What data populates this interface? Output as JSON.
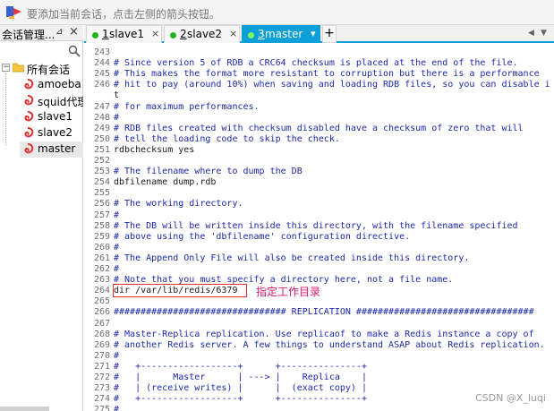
{
  "hint_bar": {
    "text": "要添加当前会话，点击左侧的箭头按钮。"
  },
  "session_panel": {
    "title": "会话管理...",
    "pin_glyph": "⊿",
    "close_glyph": "×",
    "root": "所有会话",
    "items": [
      "amoeba",
      "squid代理",
      "slave1",
      "slave2",
      "master"
    ],
    "selected": "master"
  },
  "tabs": [
    {
      "num": "1",
      "label": "slave1",
      "active": false
    },
    {
      "num": "2",
      "label": "slave2",
      "active": false
    },
    {
      "num": "3",
      "label": "master",
      "active": true
    }
  ],
  "tab_add": "+",
  "terminal": {
    "lines": [
      {
        "n": "243",
        "t": ""
      },
      {
        "n": "244",
        "t": "# Since version 5 of RDB a CRC64 checksum is placed at the end of the file."
      },
      {
        "n": "245",
        "t": "# This makes the format more resistant to corruption but there is a performance"
      },
      {
        "n": "246",
        "t": "# hit to pay (around 10%) when saving and loading RDB files, so you can disable i"
      },
      {
        "n": "",
        "t": "t"
      },
      {
        "n": "247",
        "t": "# for maximum performances."
      },
      {
        "n": "248",
        "t": "#"
      },
      {
        "n": "249",
        "t": "# RDB files created with checksum disabled have a checksum of zero that will"
      },
      {
        "n": "250",
        "t": "# tell the loading code to skip the check."
      },
      {
        "n": "251",
        "t": "rdbchecksum yes"
      },
      {
        "n": "252",
        "t": ""
      },
      {
        "n": "253",
        "t": "# The filename where to dump the DB"
      },
      {
        "n": "254",
        "t": "dbfilename dump.rdb"
      },
      {
        "n": "255",
        "t": ""
      },
      {
        "n": "256",
        "t": "# The working directory."
      },
      {
        "n": "257",
        "t": "#"
      },
      {
        "n": "258",
        "t": "# The DB will be written inside this directory, with the filename specified"
      },
      {
        "n": "259",
        "t": "# above using the 'dbfilename' configuration directive."
      },
      {
        "n": "260",
        "t": "#"
      },
      {
        "n": "261",
        "t": "# The Append Only File will also be created inside this directory."
      },
      {
        "n": "262",
        "t": "#"
      },
      {
        "n": "263",
        "t": "# Note that you must specify a directory here, not a file name."
      },
      {
        "n": "264",
        "t": "dir /var/lib/redis/6379"
      },
      {
        "n": "265",
        "t": ""
      },
      {
        "n": "266",
        "t": "################################ REPLICATION #################################"
      },
      {
        "n": "267",
        "t": ""
      },
      {
        "n": "268",
        "t": "# Master-Replica replication. Use replicaof to make a Redis instance a copy of"
      },
      {
        "n": "269",
        "t": "# another Redis server. A few things to understand ASAP about Redis replication."
      },
      {
        "n": "270",
        "t": "#"
      },
      {
        "n": "271",
        "t": "#   +------------------+      +---------------+"
      },
      {
        "n": "272",
        "t": "#   |      Master      | ---> |    Replica    |"
      },
      {
        "n": "273",
        "t": "#   | (receive writes) |      |  (exact copy) |"
      },
      {
        "n": "274",
        "t": "#   +------------------+      +---------------+"
      },
      {
        "n": "275",
        "t": "#"
      }
    ],
    "annotation": "指定工作目录"
  },
  "watermark": "CSDN @X_luqi",
  "colors": {
    "tab_active": "#0d9fd8",
    "comment": "#1d29a8",
    "annotation": "#d6186b",
    "highlight_border": "#e0302a"
  }
}
